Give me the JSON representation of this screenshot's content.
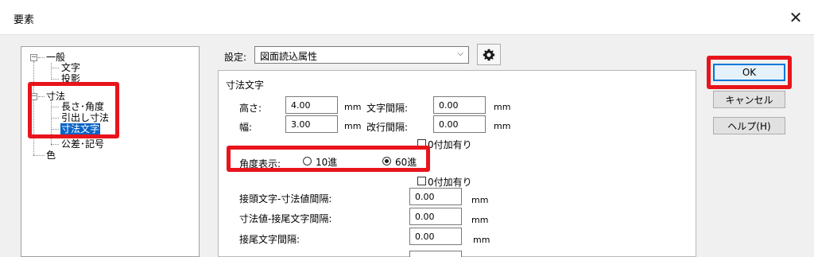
{
  "window": {
    "title": "要素",
    "close_glyph": "✕"
  },
  "tree": {
    "general": "一般",
    "text": "文字",
    "projection": "投影",
    "dimension": "寸法",
    "length_angle": "長さ･角度",
    "leader": "引出し寸法",
    "dimension_text": "寸法文字",
    "tolerance_symbol": "公差･記号",
    "color": "色",
    "expander_minus": "−"
  },
  "settings": {
    "label": "設定:",
    "selected": "図面読込属性",
    "arrow": "⌵"
  },
  "panel": {
    "group_title": "寸法文字",
    "height_label": "高さ:",
    "height_value": "4.00",
    "width_label": "幅:",
    "width_value": "3.00",
    "unit_mm": "mm",
    "char_spacing_label": "文字間隔:",
    "char_spacing_value": "0.00",
    "line_spacing_label": "改行間隔:",
    "line_spacing_value": "0.00",
    "zero_suffix_1": "0付加有り",
    "angle_label": "角度表示:",
    "angle_opt1": "10進",
    "angle_opt2": "60進",
    "zero_suffix_2": "0付加有り",
    "prefix_spacing_label": "接頭文字-寸法値間隔:",
    "prefix_spacing_value": "0.00",
    "suffix_spacing_label": "寸法値-接尾文字間隔:",
    "suffix_spacing_value": "0.00",
    "suffix_char_spacing_label": "接尾文字間隔:",
    "suffix_char_spacing_value": "0.00"
  },
  "buttons": {
    "ok": "OK",
    "cancel": "キャンセル",
    "help": "ヘルプ(H)"
  },
  "colors": {
    "annotation_red": "#e8141b",
    "selection_blue": "#0a64c8"
  }
}
